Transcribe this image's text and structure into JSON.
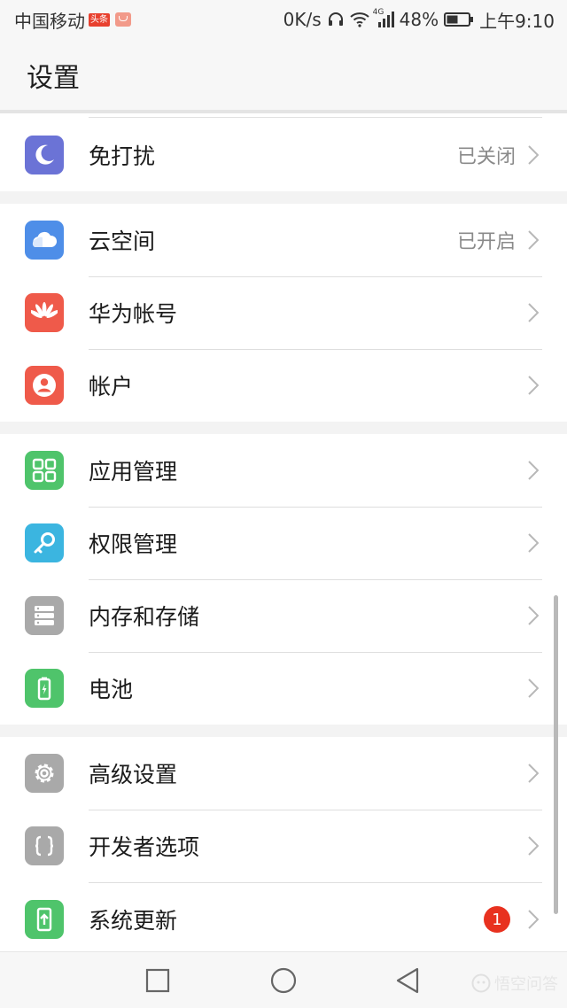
{
  "status_bar": {
    "carrier": "中国移动",
    "toutiao_badge": "头条",
    "net_speed": "0K/s",
    "network_type": "4G",
    "battery_percent": "48%",
    "time": "上午9:10"
  },
  "header": {
    "title": "设置"
  },
  "groups": [
    {
      "items": [
        {
          "label": "免打扰",
          "status": "已关闭",
          "icon": "moon-icon",
          "color": "#6b73d6"
        }
      ]
    },
    {
      "items": [
        {
          "label": "云空间",
          "status": "已开启",
          "icon": "cloud-icon",
          "color": "#4e8ee8"
        },
        {
          "label": "华为帐号",
          "status": "",
          "icon": "huawei-icon",
          "color": "#ef5a4a"
        },
        {
          "label": "帐户",
          "status": "",
          "icon": "account-icon",
          "color": "#ef5a4a"
        }
      ]
    },
    {
      "items": [
        {
          "label": "应用管理",
          "status": "",
          "icon": "app-grid-icon",
          "color": "#4fc46b"
        },
        {
          "label": "权限管理",
          "status": "",
          "icon": "key-icon",
          "color": "#3bb5e0"
        },
        {
          "label": "内存和存储",
          "status": "",
          "icon": "storage-icon",
          "color": "#a9a9a9"
        },
        {
          "label": "电池",
          "status": "",
          "icon": "battery-icon",
          "color": "#4fc46b"
        }
      ]
    },
    {
      "items": [
        {
          "label": "高级设置",
          "status": "",
          "icon": "gear-icon",
          "color": "#a9a9a9"
        },
        {
          "label": "开发者选项",
          "status": "",
          "icon": "braces-icon",
          "color": "#a9a9a9"
        },
        {
          "label": "系统更新",
          "badge": "1",
          "icon": "update-icon",
          "color": "#4fc46b"
        }
      ]
    }
  ],
  "nav_bar": {
    "watermark": "悟空问答"
  }
}
